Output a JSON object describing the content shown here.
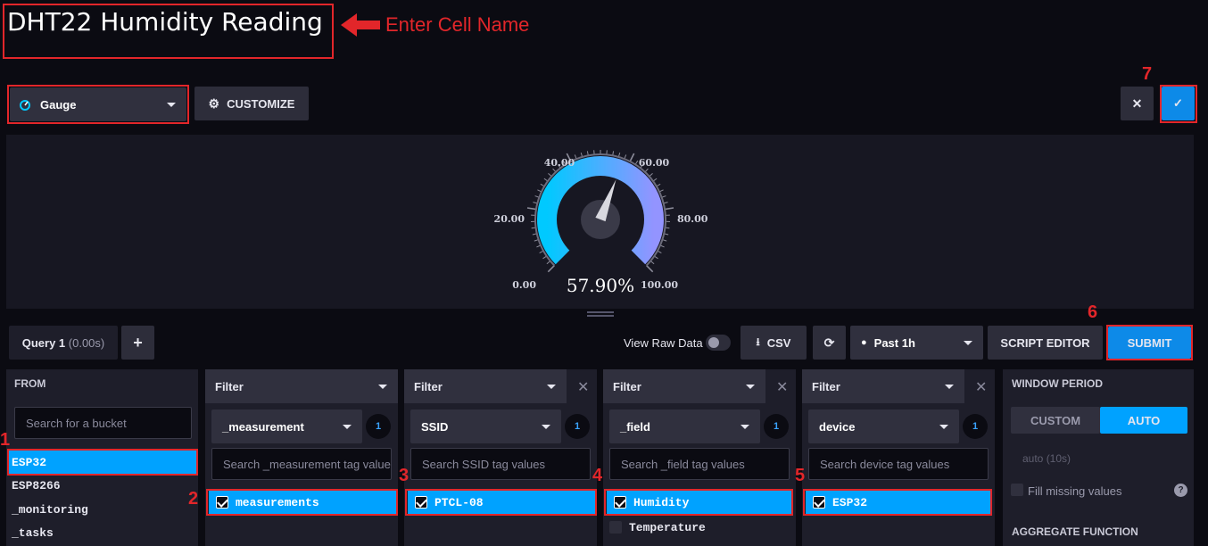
{
  "cell": {
    "title": "DHT22 Humidity Reading",
    "annotation": "Enter Cell Name"
  },
  "toolbar": {
    "vis_type": "Gauge",
    "customize_label": "CUSTOMIZE",
    "cancel_icon": "close-icon",
    "confirm_icon": "check-icon"
  },
  "gauge": {
    "value": 57.9,
    "value_label": "57.90%",
    "min": 0,
    "max": 100,
    "tick_labels": [
      "0.00",
      "20.00",
      "40.00",
      "60.00",
      "80.00",
      "100.00"
    ],
    "colors": {
      "start": "#00c9ff",
      "end": "#9394ff"
    }
  },
  "query_bar": {
    "query_tab": "Query 1",
    "query_time": "(0.00s)",
    "add_label": "+",
    "view_raw_label": "View Raw Data",
    "csv_label": "CSV",
    "time_range": "Past 1h",
    "script_editor_label": "SCRIPT EDITOR",
    "submit_label": "SUBMIT"
  },
  "from": {
    "header": "FROM",
    "search_placeholder": "Search for a bucket",
    "buckets": [
      "ESP32",
      "ESP8266",
      "_monitoring",
      "_tasks"
    ],
    "selected": "ESP32"
  },
  "filters": [
    {
      "header": "Filter",
      "key": "_measurement",
      "count": "1",
      "search_placeholder": "Search _measurement tag values",
      "values": [
        {
          "label": "measurements",
          "checked": true
        }
      ]
    },
    {
      "header": "Filter",
      "key": "SSID",
      "count": "1",
      "search_placeholder": "Search SSID tag values",
      "values": [
        {
          "label": "PTCL-08",
          "checked": true
        }
      ]
    },
    {
      "header": "Filter",
      "key": "_field",
      "count": "1",
      "search_placeholder": "Search _field tag values",
      "values": [
        {
          "label": "Humidity",
          "checked": true
        },
        {
          "label": "Temperature",
          "checked": false
        }
      ]
    },
    {
      "header": "Filter",
      "key": "device",
      "count": "1",
      "search_placeholder": "Search device tag values",
      "values": [
        {
          "label": "ESP32",
          "checked": true
        }
      ]
    }
  ],
  "window_period": {
    "header": "WINDOW PERIOD",
    "custom_label": "CUSTOM",
    "auto_label": "AUTO",
    "auto_value": "auto (10s)",
    "fill_missing_label": "Fill missing values",
    "help_icon": "help-icon",
    "aggregate_header": "AGGREGATE FUNCTION"
  },
  "annotations": [
    "1",
    "2",
    "3",
    "4",
    "5",
    "6",
    "7"
  ],
  "colors": {
    "accent": "#00a2ff",
    "annotation_red": "#e2262a",
    "background": "#0b0b12",
    "panel": "#1e1e2a"
  }
}
